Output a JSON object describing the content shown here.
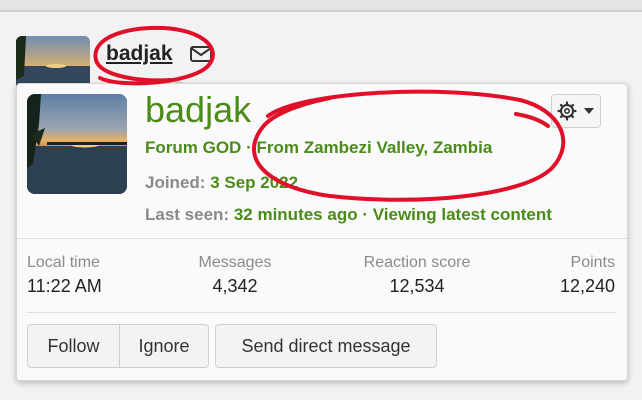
{
  "post": {
    "username": "badjak",
    "title_peek": "Forum GOD"
  },
  "card": {
    "name": "badjak",
    "title": "Forum GOD",
    "separator": "·",
    "location": "From Zambezi Valley, Zambia",
    "joined_label": "Joined:",
    "joined_value": "3 Sep 2022",
    "lastseen_label": "Last seen:",
    "lastseen_value": "32 minutes ago",
    "activity": "Viewing latest content",
    "gear_icon": "gear-icon",
    "stats": [
      {
        "label": "Local time",
        "value": "11:22 AM"
      },
      {
        "label": "Messages",
        "value": "4,342"
      },
      {
        "label": "Reaction score",
        "value": "12,534"
      },
      {
        "label": "Points",
        "value": "12,240"
      }
    ],
    "buttons": {
      "follow": "Follow",
      "ignore": "Ignore",
      "message": "Send direct message"
    }
  },
  "colors": {
    "accent_green": "#4b8b1a",
    "annotation_red": "#e0102a"
  }
}
